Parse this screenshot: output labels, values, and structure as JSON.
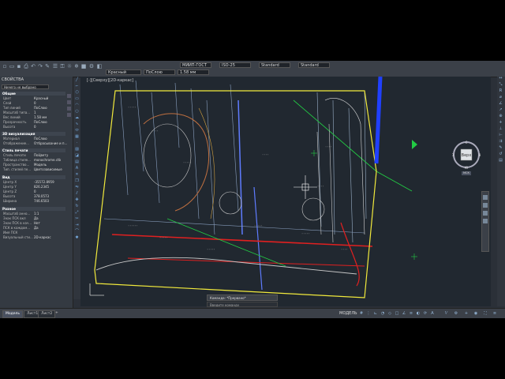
{
  "toolbar": {
    "layer_dropdown": "Красный",
    "linetype_dropdown": "ПоСлою",
    "lineweight_dropdown": "1.58 мм",
    "style_dropdowns": [
      "МИИП-ГОСТ",
      "ISO-25",
      "Standard",
      "Standard"
    ],
    "icons": [
      "new-icon",
      "open-icon",
      "save-icon",
      "print-icon",
      "undo-icon",
      "redo-icon",
      "match-icon",
      "layer-icon",
      "lock-icon",
      "sun-icon",
      "freeze-icon",
      "color-icon",
      "props-icon"
    ]
  },
  "properties_panel": {
    "title": "СВОЙСТВА",
    "selection": "Ничего не выбрано",
    "sections": [
      {
        "title": "Общие",
        "rows": [
          [
            "Цвет",
            "Красный"
          ],
          [
            "Слой",
            "0"
          ],
          [
            "Тип линий",
            "ПоСлою"
          ],
          [
            "Масштаб типа...",
            "1"
          ],
          [
            "Вес линий",
            "1.58 мм"
          ],
          [
            "Прозрачность",
            "ПоСлою"
          ],
          [
            "Высота",
            "0"
          ]
        ]
      },
      {
        "title": "3D визуализация",
        "rows": [
          [
            "Материал",
            "ПоСлою"
          ],
          [
            "Отображение...",
            "Отбрасывание и п..."
          ]
        ]
      },
      {
        "title": "Стиль печати",
        "rows": [
          [
            "Стиль печати",
            "ПоЦвету"
          ],
          [
            "Таблица стиле...",
            "monochrome.ctb"
          ],
          [
            "Пространство...",
            "Модель"
          ],
          [
            "Тип. стилей пе...",
            "Цветозависимые"
          ]
        ]
      },
      {
        "title": "Вид",
        "rows": [
          [
            "Центр X",
            "-35572.8959"
          ],
          [
            "Центр Y",
            "826.2345"
          ],
          [
            "Центр Z",
            "0"
          ],
          [
            "Высота",
            "378.0573"
          ],
          [
            "Ширина",
            "746.6503"
          ]
        ]
      },
      {
        "title": "Разное",
        "rows": [
          [
            "Масштаб анно...",
            "1:1"
          ],
          [
            "Знак ПСК вкл",
            "Да"
          ],
          [
            "Знак ПСК в нач...",
            "Нет"
          ],
          [
            "ПСК в каждом...",
            "Да"
          ],
          [
            "Имя ПСК",
            ""
          ],
          [
            "Визуальный сти...",
            "2D-каркас"
          ]
        ]
      }
    ]
  },
  "viewport": {
    "label": "[-][Сверху][2D-каркас]",
    "viewcube_face": "Верх",
    "compass_labels": {
      "n": "С",
      "s": "Ю",
      "e": "В",
      "w": "З"
    },
    "wcs_label": "МСК"
  },
  "command_line": {
    "history": "Команда: *Прервано*",
    "prompt": "Введите команду"
  },
  "status_bar": {
    "tabs": [
      "Модель",
      "Лист1",
      "Лист2"
    ],
    "add_tab": "+",
    "model_label": "МОДЕЛЬ"
  },
  "colors": {
    "app_bg": "#2b3038",
    "canvas_bg": "#212830",
    "boundary": "#f2ea3c",
    "road": "#4060ff",
    "utility": "#e02020",
    "green_line": "#22cc44"
  }
}
